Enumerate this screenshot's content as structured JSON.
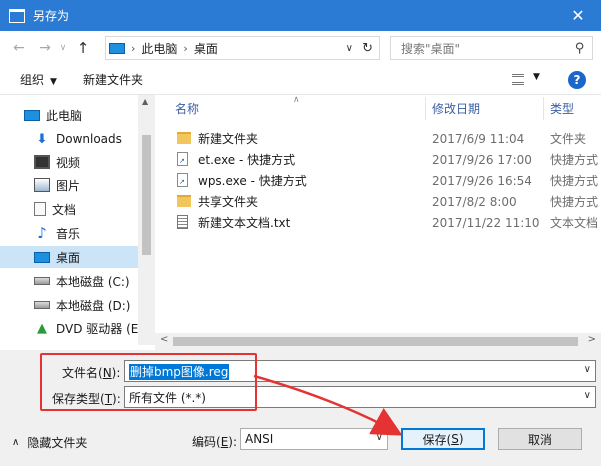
{
  "window": {
    "title": "另存为",
    "close_label": "✕"
  },
  "nav": {
    "back": "←",
    "forward": "→",
    "dropdown": "∨",
    "up": "↑"
  },
  "address": {
    "crumbs": [
      "此电脑",
      "桌面"
    ],
    "separator": "›",
    "dropdown": "∨",
    "refresh": "↻"
  },
  "search": {
    "placeholder": "搜索\"桌面\"",
    "icon": "search-icon"
  },
  "toolbar": {
    "organize": "组织",
    "new_folder": "新建文件夹",
    "dropdown": "▼",
    "help": "?"
  },
  "sidebar": {
    "items": [
      {
        "label": "此电脑",
        "icon": "computer-icon"
      },
      {
        "label": "Downloads",
        "icon": "download-arrow-icon"
      },
      {
        "label": "视频",
        "icon": "video-icon"
      },
      {
        "label": "图片",
        "icon": "picture-icon"
      },
      {
        "label": "文档",
        "icon": "document-icon"
      },
      {
        "label": "音乐",
        "icon": "music-note-icon"
      },
      {
        "label": "桌面",
        "icon": "desktop-icon",
        "selected": true
      },
      {
        "label": "本地磁盘 (C:)",
        "icon": "drive-windows-icon"
      },
      {
        "label": "本地磁盘 (D:)",
        "icon": "drive-icon"
      },
      {
        "label": "DVD 驱动器 (E:",
        "icon": "dvd-drive-icon"
      }
    ]
  },
  "filelist": {
    "columns": {
      "name": "名称",
      "date": "修改日期",
      "type": "类型"
    },
    "rows": [
      {
        "name": "新建文件夹",
        "date": "2017/6/9 11:04",
        "type": "文件夹",
        "icon": "folder"
      },
      {
        "name": "et.exe - 快捷方式",
        "date": "2017/9/26 17:00",
        "type": "快捷方式",
        "icon": "shortcut"
      },
      {
        "name": "wps.exe - 快捷方式",
        "date": "2017/9/26 16:54",
        "type": "快捷方式",
        "icon": "shortcut"
      },
      {
        "name": "共享文件夹",
        "date": "2017/8/2 8:00",
        "type": "快捷方式",
        "icon": "folder-shortcut"
      },
      {
        "name": "新建文本文档.txt",
        "date": "2017/11/22 11:10",
        "type": "文本文档",
        "icon": "txt"
      }
    ]
  },
  "form": {
    "filename_label": "文件名(",
    "filename_key": "N",
    "filename_label_end": "):",
    "filename_value": "删掉bmp图像.reg",
    "filetype_label": "保存类型(",
    "filetype_key": "T",
    "filetype_label_end": "):",
    "filetype_value": "所有文件  (*.*)",
    "encoding_label": "编码(",
    "encoding_key": "E",
    "encoding_label_end": "):",
    "encoding_value": "ANSI"
  },
  "footer": {
    "hide_folders": "隐藏文件夹",
    "chevron": "∧"
  },
  "buttons": {
    "save": "保存(",
    "save_key": "S",
    "save_end": ")",
    "cancel": "取消"
  },
  "colors": {
    "titlebar": "#2b7bd4",
    "selection": "#cce4f7",
    "highlight": "#0078d7",
    "annotation": "#e53232"
  }
}
